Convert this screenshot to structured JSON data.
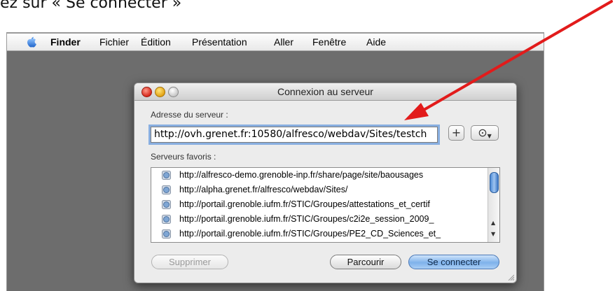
{
  "instruction": "ez sur « Se connecter »",
  "menubar": {
    "items": [
      "Finder",
      "Fichier",
      "Édition",
      "Présentation",
      "Aller",
      "Fenêtre",
      "Aide"
    ]
  },
  "dialog": {
    "title": "Connexion au serveur",
    "address_label": "Adresse du serveur :",
    "address_value": "http://ovh.grenet.fr:10580/alfresco/webdav/Sites/testch",
    "add_button": "+",
    "recent_button": "⊙",
    "favorites_label": "Serveurs favoris :",
    "favorites": [
      "http://alfresco-demo.grenoble-inp.fr/share/page/site/baousages",
      "http://alpha.grenet.fr/alfresco/webdav/Sites/",
      "http://portail.grenoble.iufm.fr/STIC/Groupes/attestations_et_certif",
      "http://portail.grenoble.iufm.fr/STIC/Groupes/c2i2e_session_2009_",
      "http://portail.grenoble.iufm.fr/STIC/Groupes/PE2_CD_Sciences_et_"
    ],
    "buttons": {
      "delete": "Supprimer",
      "browse": "Parcourir",
      "connect": "Se connecter"
    }
  },
  "colors": {
    "arrow": "#e21b1b",
    "connect_button": "#7fb2eb",
    "focus_ring": "#88aee0"
  }
}
